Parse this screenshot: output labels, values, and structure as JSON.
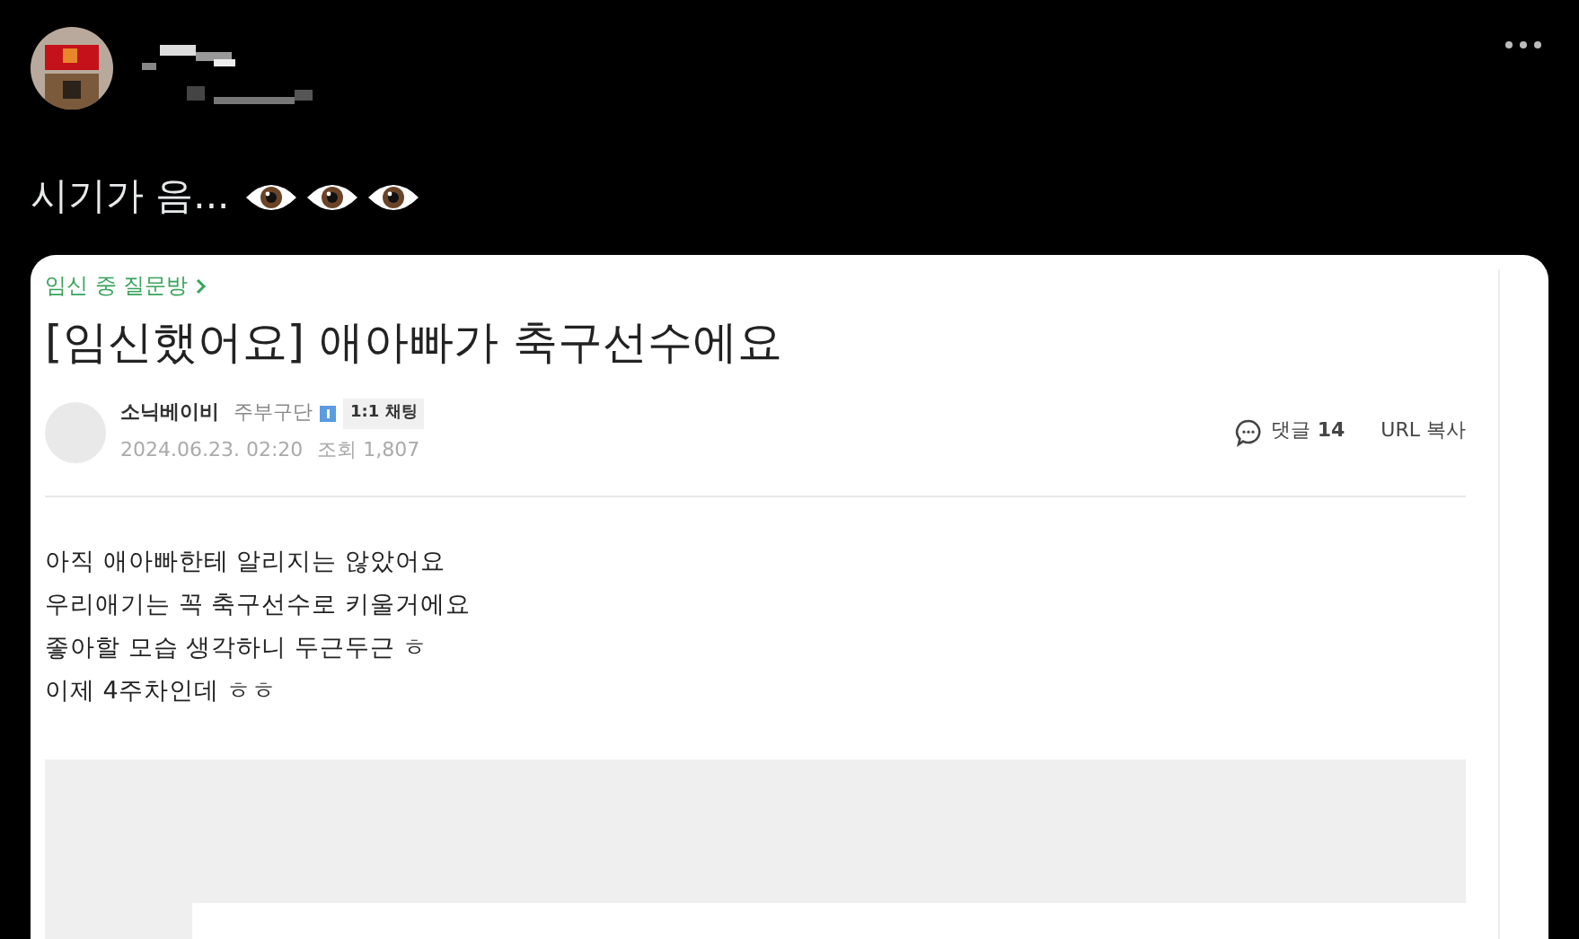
{
  "tweet": {
    "text": "시기가 음..."
  },
  "post": {
    "category": "임신 중 질문방",
    "title": "[임신했어요] 애아빠가 축구선수에요",
    "author": {
      "name": "소닉베이비",
      "grade": "주부구단",
      "chat": "1:1 채팅"
    },
    "date": "2024.06.23. 02:20",
    "views": "조회 1,807",
    "comments": {
      "label": "댓글",
      "count": "14"
    },
    "url_copy": "URL 복사",
    "body": [
      "아직 애아빠한테 알리지는 않았어요",
      "우리애기는 꼭 축구선수로 키울거에요",
      "좋아할 모습 생각하니 두근두근 ㅎ",
      "이제 4주차인데 ㅎㅎ"
    ]
  }
}
